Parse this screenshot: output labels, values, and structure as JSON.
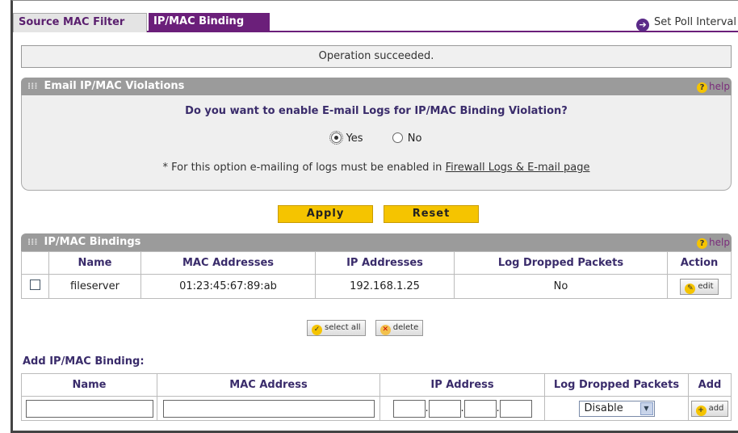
{
  "tabs": {
    "source_mac": "Source MAC Filter",
    "ip_mac": "IP/MAC Binding"
  },
  "poll": {
    "label": "Set Poll Interval"
  },
  "status": {
    "message": "Operation succeeded."
  },
  "email_section": {
    "title": "Email IP/MAC Violations",
    "help": "help",
    "question": "Do you want to enable E-mail Logs for IP/MAC Binding Violation?",
    "yes": "Yes",
    "no": "No",
    "selected": "Yes",
    "note_prefix": "* For this option e-mailing of logs must be enabled in ",
    "note_link": "Firewall Logs & E-mail page"
  },
  "actions": {
    "apply": "Apply",
    "reset": "Reset"
  },
  "bindings_section": {
    "title": "IP/MAC Bindings",
    "help": "help",
    "columns": [
      "Name",
      "MAC Addresses",
      "IP Addresses",
      "Log Dropped Packets",
      "Action"
    ],
    "rows": [
      {
        "name": "fileserver",
        "mac": "01:23:45:67:89:ab",
        "ip": "192.168.1.25",
        "log": "No",
        "action": "edit"
      }
    ],
    "select_all": "select all",
    "delete": "delete"
  },
  "add_section": {
    "title": "Add IP/MAC Binding:",
    "columns": [
      "Name",
      "MAC Address",
      "IP Address",
      "Log Dropped Packets",
      "Add"
    ],
    "log_value": "Disable",
    "add": "add"
  },
  "colors": {
    "accent": "#6b1f7a",
    "button": "#f5c400",
    "header": "#9b9b9b"
  }
}
